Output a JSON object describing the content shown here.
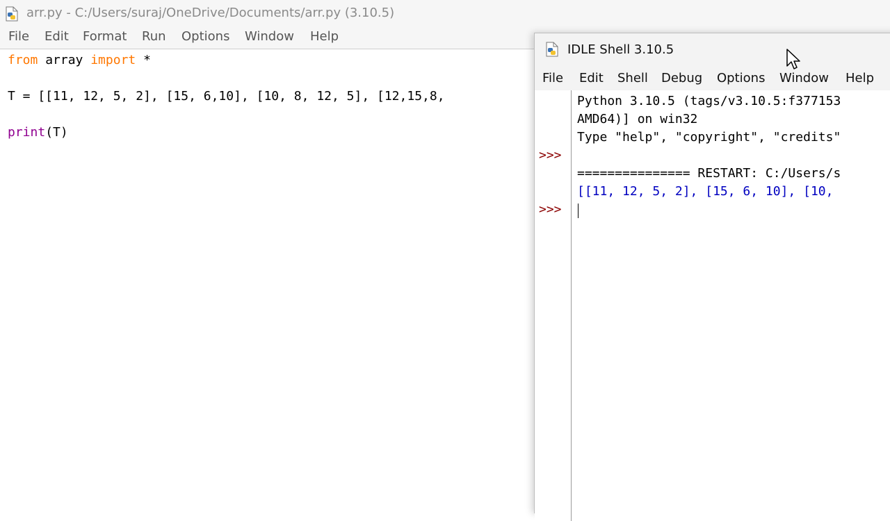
{
  "editor": {
    "title": "arr.py - C:/Users/suraj/OneDrive/Documents/arr.py (3.10.5)",
    "icon": "python-file-icon",
    "menu": [
      "File",
      "Edit",
      "Format",
      "Run",
      "Options",
      "Window",
      "Help"
    ],
    "code": {
      "line1_kw1": "from",
      "line1_mid": " array ",
      "line1_kw2": "import",
      "line1_end": " *",
      "line2": "T = [[11, 12, 5, 2], [15, 6,10], [10, 8, 12, 5], [12,15,8,",
      "line3_fn": "print",
      "line3_rest": "(T)"
    }
  },
  "shell": {
    "title": "IDLE Shell 3.10.5",
    "icon": "python-shell-icon",
    "menu": [
      "File",
      "Edit",
      "Shell",
      "Debug",
      "Options",
      "Window",
      "Help"
    ],
    "prompt": ">>>",
    "lines": {
      "l1": "Python 3.10.5 (tags/v3.10.5:f377153",
      "l2": "AMD64)] on win32",
      "l3": "Type \"help\", \"copyright\", \"credits\"",
      "l4": "=============== RESTART: C:/Users/s",
      "l5": "[[11, 12, 5, 2], [15, 6, 10], [10,"
    }
  },
  "colors": {
    "keyword": "#ff7700",
    "builtin": "#900090",
    "prompt": "#8b0000",
    "output": "#0000c0"
  }
}
